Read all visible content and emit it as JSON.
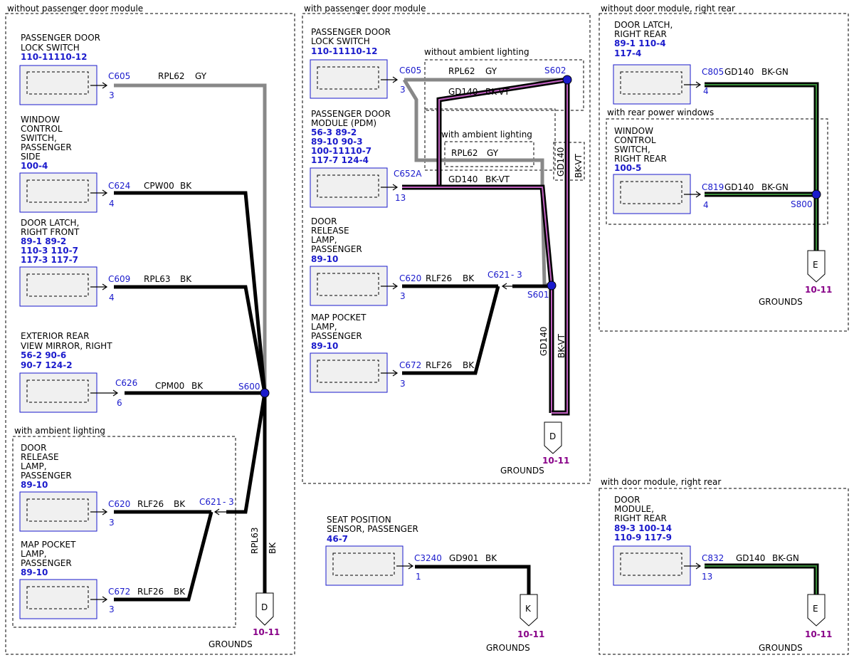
{
  "sections": {
    "without_pdm": "without passenger door module",
    "with_pdm": "with passenger door module",
    "without_door_module_rr": "without door module, right rear",
    "with_door_module_rr": "with door module, right rear",
    "ambient_left": "with ambient lighting",
    "without_ambient_mid": "without ambient lighting",
    "with_ambient_mid": "with ambient lighting",
    "rear_power_windows": "with rear power windows"
  },
  "components": {
    "left_lock_switch": {
      "l1": "PASSENGER DOOR",
      "l2": "LOCK SWITCH",
      "refs": "110-11110-12"
    },
    "left_window_switch": {
      "l1": "WINDOW",
      "l2": "CONTROL",
      "l3": "SWITCH,",
      "l4": "PASSENGER",
      "l5": "SIDE",
      "refs": "100-4"
    },
    "left_door_latch": {
      "l1": "DOOR LATCH,",
      "l2": "RIGHT FRONT",
      "r1": "89-1   89-2",
      "r2": "110-3 110-7",
      "r3": "117-3 117-7"
    },
    "left_mirror": {
      "l1": "EXTERIOR REAR",
      "l2": "VIEW MIRROR, RIGHT",
      "r1": "56-2   90-6",
      "r2": "90-7   124-2"
    },
    "left_release_lamp": {
      "l1": "DOOR",
      "l2": "RELEASE",
      "l3": "LAMP,",
      "l4": "PASSENGER",
      "refs": "89-10"
    },
    "left_map_lamp": {
      "l1": "MAP POCKET",
      "l2": "LAMP,",
      "l3": "PASSENGER",
      "refs": "89-10"
    },
    "mid_lock_switch": {
      "l1": "PASSENGER DOOR",
      "l2": "LOCK SWITCH",
      "refs": "110-11110-12"
    },
    "mid_pdm": {
      "l1": "PASSENGER DOOR",
      "l2": "MODULE (PDM)",
      "r1": "56-3   89-2",
      "r2": "89-10 90-3",
      "r3": "100-11110-7",
      "r4": "117-7 124-4"
    },
    "mid_release_lamp": {
      "l1": "DOOR",
      "l2": "RELEASE",
      "l3": "LAMP,",
      "l4": "PASSENGER",
      "refs": "89-10"
    },
    "mid_map_lamp": {
      "l1": "MAP POCKET",
      "l2": "LAMP,",
      "l3": "PASSENGER",
      "refs": "89-10"
    },
    "seat_sensor": {
      "l1": "SEAT POSITION",
      "l2": "SENSOR, PASSENGER",
      "refs": "46-7"
    },
    "rr_door_latch": {
      "l1": "DOOR LATCH,",
      "l2": "RIGHT REAR",
      "r1": "89-1 110-4",
      "r2": "117-4"
    },
    "rr_window_switch": {
      "l1": "WINDOW",
      "l2": "CONTROL",
      "l3": "SWITCH,",
      "l4": "RIGHT REAR",
      "refs": "100-5"
    },
    "rr_door_module": {
      "l1": "DOOR",
      "l2": "MODULE,",
      "l3": "RIGHT REAR",
      "r1": "89-3     100-14",
      "r2": "110-9 117-9"
    }
  },
  "connectors": {
    "c605_l": "C605",
    "c624": "C624",
    "c609": "C609",
    "c626": "C626",
    "c620_l": "C620",
    "c672_l": "C672",
    "c621_l": "C621",
    "c605_m": "C605",
    "c652a": "C652A",
    "c620_m": "C620",
    "c672_m": "C672",
    "c621_m": "C621",
    "c3240": "C3240",
    "c805": "C805",
    "c819": "C819",
    "c832": "C832"
  },
  "pins": {
    "p3": "3",
    "p4": "4",
    "p6": "6",
    "p13": "13",
    "p1": "1"
  },
  "wires": {
    "rpl62": "RPL62",
    "gy": "GY",
    "cpw00": "CPW00",
    "rpl63": "RPL63",
    "bk": "BK",
    "cpm00": "CPM00",
    "rlf26": "RLF26",
    "gd140": "GD140",
    "bkvt": "BK-VT",
    "gd901": "GD901",
    "bkgn": "BK-GN",
    "dash3": "- 3"
  },
  "splices": {
    "s600": "S600",
    "s602": "S602",
    "s601": "S601",
    "s800": "S800"
  },
  "grounds": {
    "d": "D",
    "k": "K",
    "e": "E",
    "page": "10-11",
    "label": "GROUNDS"
  },
  "colors": {
    "ref_blue": "#1a1acc",
    "page_purple": "#880088",
    "wire_gray": "#888888",
    "violet": "#c060c0",
    "green": "#3a8a3a"
  }
}
